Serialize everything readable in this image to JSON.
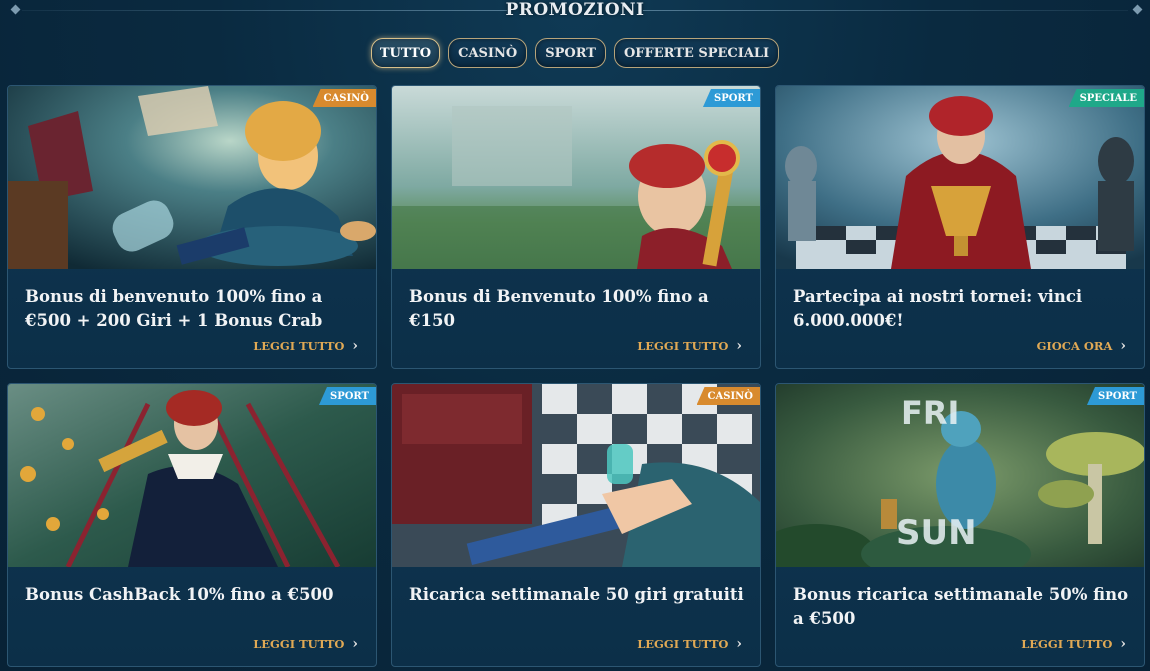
{
  "page": {
    "title": "PROMOZIONI"
  },
  "tabs": [
    {
      "label": "TUTTO",
      "active": true
    },
    {
      "label": "CASINÒ",
      "active": false
    },
    {
      "label": "SPORT",
      "active": false
    },
    {
      "label": "OFFERTE SPECIALI",
      "active": false
    }
  ],
  "cards": [
    {
      "badge": "CASINÒ",
      "badge_kind": "casino",
      "title": "Bonus di benvenuto 100% fino a €500 + 200 Giri + 1 Bonus Crab",
      "cta": "LEGGI TUTTO"
    },
    {
      "badge": "SPORT",
      "badge_kind": "sport",
      "title": "Bonus di Benvenuto 100% fino a €150",
      "cta": "LEGGI TUTTO"
    },
    {
      "badge": "SPECIALE",
      "badge_kind": "speciale",
      "title": "Partecipa ai nostri tornei: vinci 6.000.000€!",
      "cta": "GIOCA ORA"
    },
    {
      "badge": "SPORT",
      "badge_kind": "sport",
      "title": "Bonus CashBack 10% fino a €500",
      "cta": "LEGGI TUTTO"
    },
    {
      "badge": "CASINÒ",
      "badge_kind": "casino",
      "title": "Ricarica settimanale 50 giri gratuiti",
      "cta": "LEGGI TUTTO"
    },
    {
      "badge": "SPORT",
      "badge_kind": "sport",
      "title": "Bonus ricarica settimanale 50% fino a €500",
      "cta": "LEGGI TUTTO"
    }
  ],
  "colors": {
    "accent_gold": "#e0a955",
    "casino": "#d88a2e",
    "sport": "#2d9ad6",
    "speciale": "#1fa889"
  }
}
